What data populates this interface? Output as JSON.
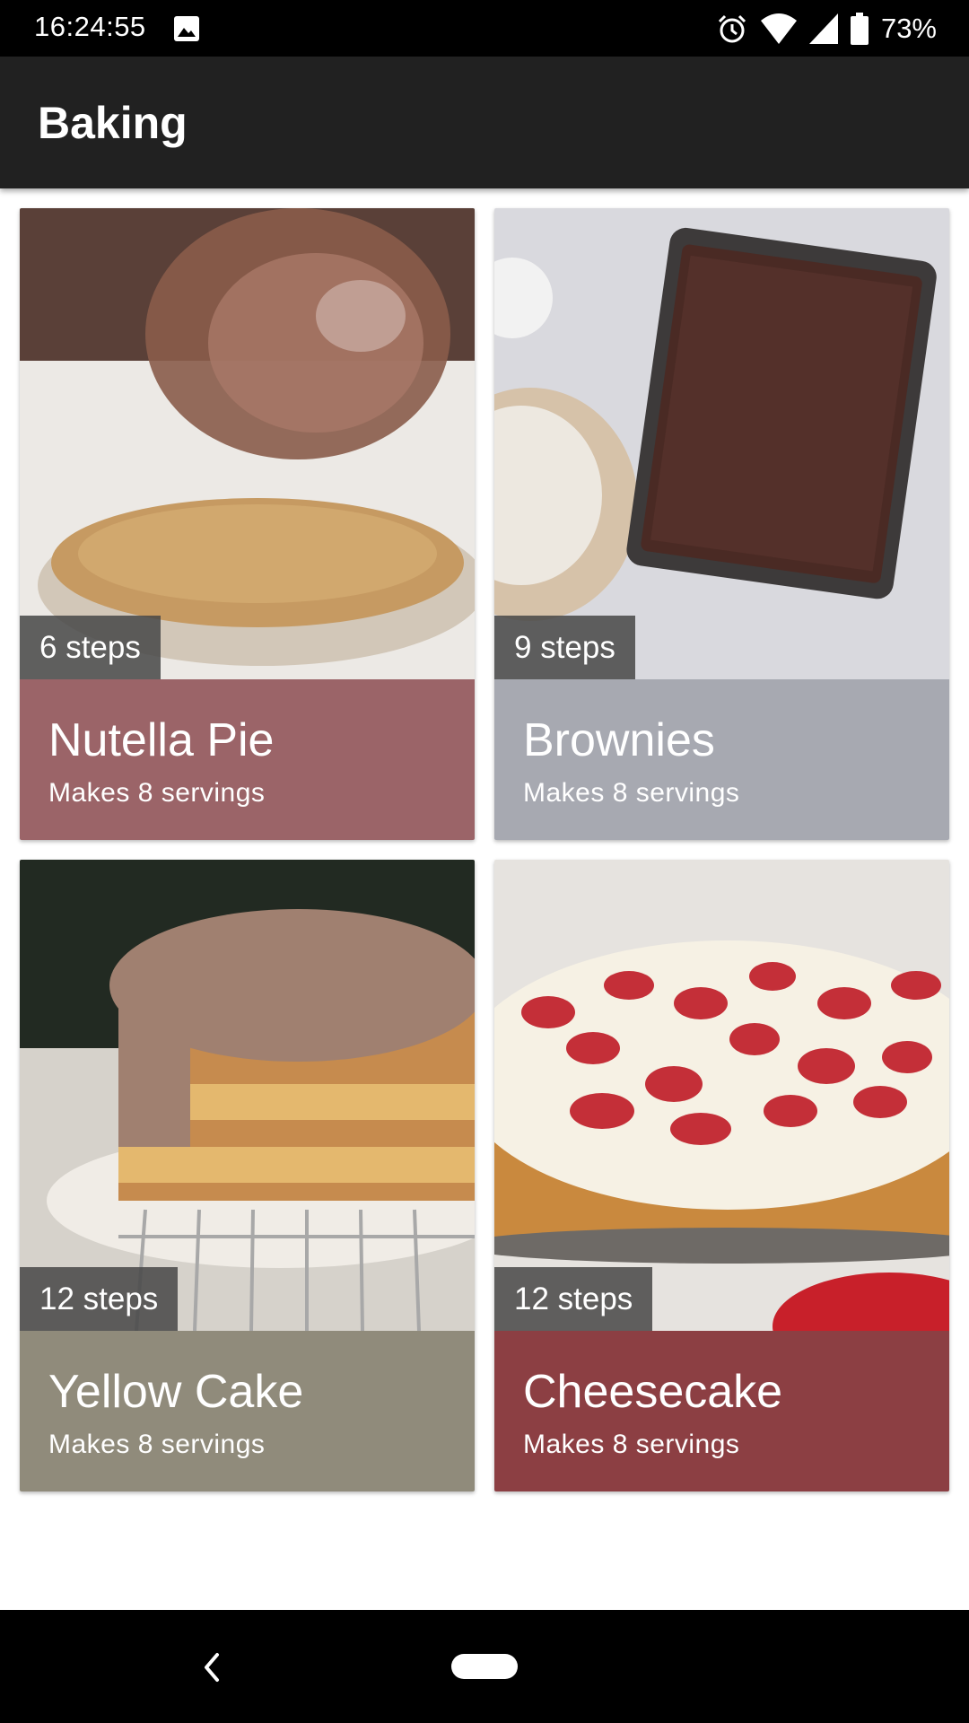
{
  "status_bar": {
    "time": "16:24:55",
    "battery": "73%",
    "icons": [
      "gallery-icon",
      "alarm-icon",
      "wifi-icon",
      "signal-icon",
      "battery-icon"
    ]
  },
  "app_bar": {
    "title": "Baking"
  },
  "recipes": [
    {
      "name": "Nutella Pie",
      "steps": "6 steps",
      "servings": "Makes 8 servings",
      "color": "#9B6468"
    },
    {
      "name": "Brownies",
      "steps": "9 steps",
      "servings": "Makes 8 servings",
      "color": "#A7A9B1"
    },
    {
      "name": "Yellow Cake",
      "steps": "12 steps",
      "servings": "Makes 8 servings",
      "color": "#908B7B"
    },
    {
      "name": "Cheesecake",
      "steps": "12 steps",
      "servings": "Makes 8 servings",
      "color": "#8C3F43"
    }
  ],
  "nav_bar": {
    "icons": [
      "back-icon",
      "home-pill"
    ]
  }
}
